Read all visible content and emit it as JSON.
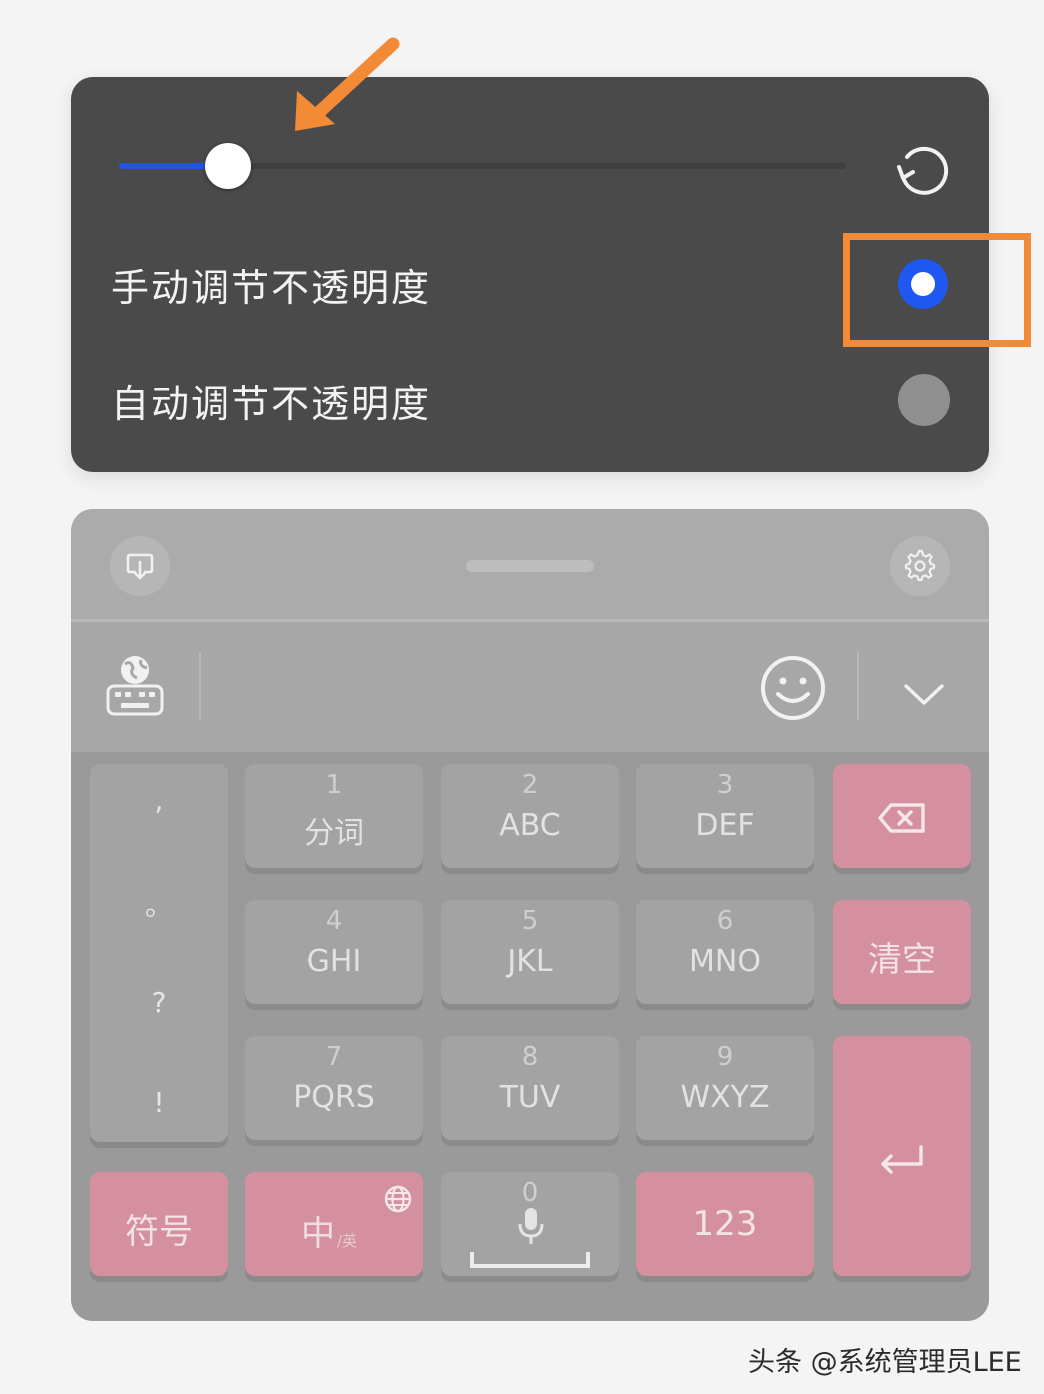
{
  "opacity_panel": {
    "slider_value_percent": 15,
    "options": [
      {
        "label": "手动调节不透明度",
        "selected": true
      },
      {
        "label": "自动调节不透明度",
        "selected": false
      }
    ]
  },
  "keyboard": {
    "toolbar_icons": [
      "keyboard-language-icon",
      "emoji-icon",
      "chevron-down-icon"
    ],
    "topbar_icons": [
      "float-keyboard-icon",
      "settings-gear-icon"
    ],
    "punctuation": [
      ",",
      "。",
      "?",
      "!"
    ],
    "keys": [
      {
        "num": "1",
        "label": "分词"
      },
      {
        "num": "2",
        "label": "ABC"
      },
      {
        "num": "3",
        "label": "DEF"
      },
      {
        "num": "4",
        "label": "GHI"
      },
      {
        "num": "5",
        "label": "JKL"
      },
      {
        "num": "6",
        "label": "MNO"
      },
      {
        "num": "7",
        "label": "PQRS"
      },
      {
        "num": "8",
        "label": "TUV"
      },
      {
        "num": "9",
        "label": "WXYZ"
      }
    ],
    "clear_label": "清空",
    "symbols_label": "符号",
    "chinese_label": "中",
    "chinese_sub_label": "/英",
    "zero_num": "0",
    "numbers_label": "123",
    "accent_color": "#d4909f"
  },
  "watermark": "头条 @系统管理员LEE",
  "annotation_color": "#f28a36",
  "selected_radio_color": "#1e58f0"
}
